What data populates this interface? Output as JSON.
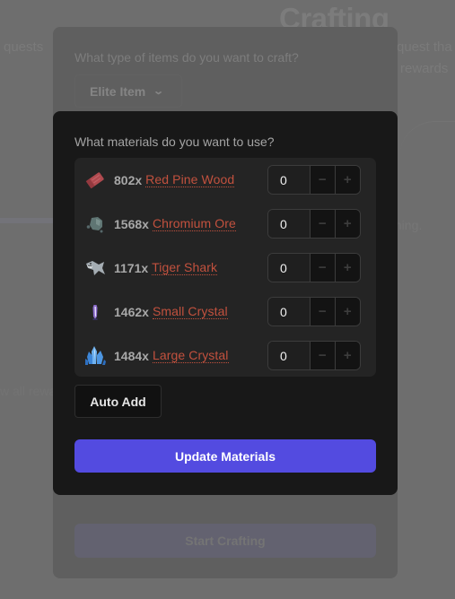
{
  "background": {
    "title": "Crafting",
    "text_left": "quests",
    "text_right_1": "quest tha",
    "text_right_2": "rewards",
    "text_mid_right": "thing.",
    "text_lower_left": "w all rewa"
  },
  "craft_type": {
    "question": "What type of items do you want to craft?",
    "selected": "Elite Item",
    "chevron": "chevron-down-icon"
  },
  "start_button": {
    "label": "Start Crafting"
  },
  "materials_modal": {
    "question": "What materials do you want to use?",
    "materials": [
      {
        "count": "802x",
        "name": "Red Pine Wood",
        "icon": "wood-plank-icon",
        "value": "0"
      },
      {
        "count": "1568x",
        "name": "Chromium Ore",
        "icon": "ore-rock-icon",
        "value": "0"
      },
      {
        "count": "1171x",
        "name": "Tiger Shark",
        "icon": "shark-icon",
        "value": "0"
      },
      {
        "count": "1462x",
        "name": "Small Crystal",
        "icon": "small-crystal-icon",
        "value": "0"
      },
      {
        "count": "1484x",
        "name": "Large Crystal",
        "icon": "large-crystal-icon",
        "value": "0"
      }
    ],
    "stepper_minus": "−",
    "stepper_plus": "+",
    "auto_add_label": "Auto Add",
    "update_label": "Update Materials"
  },
  "colors": {
    "accent": "#534be0",
    "link": "#c2513e",
    "modal_bg": "#181818",
    "overlay_bg": "#6e6e6e"
  }
}
